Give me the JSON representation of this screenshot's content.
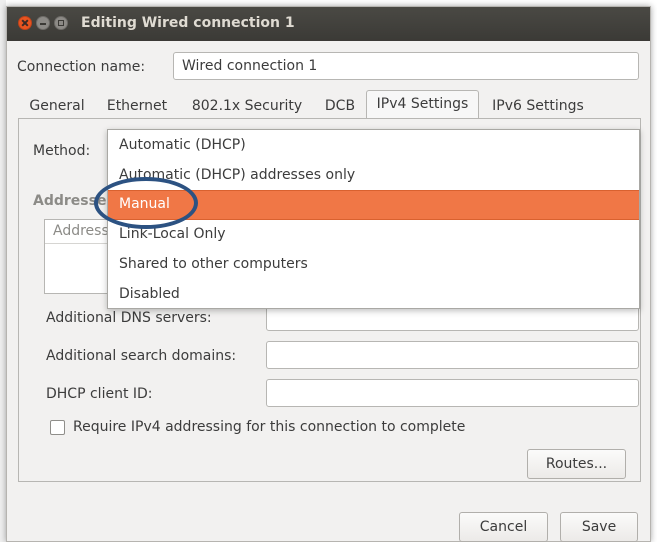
{
  "window": {
    "title": "Editing Wired connection 1"
  },
  "connection": {
    "label": "Connection name:",
    "value": "Wired connection 1"
  },
  "tabs": [
    {
      "label": "General"
    },
    {
      "label": "Ethernet"
    },
    {
      "label": "802.1x Security"
    },
    {
      "label": "DCB"
    },
    {
      "label": "IPv4 Settings"
    },
    {
      "label": "IPv6 Settings"
    }
  ],
  "active_tab": "IPv4 Settings",
  "ipv4": {
    "method_label": "Method:",
    "addresses_label": "Addresses",
    "addresses_column": "Address",
    "dns_label": "Additional DNS servers:",
    "search_label": "Additional search domains:",
    "dhcp_label": "DHCP client ID:",
    "require_label": "Require IPv4 addressing for this connection to complete",
    "routes_button": "Routes..."
  },
  "method_dropdown": {
    "options": [
      "Automatic (DHCP)",
      "Automatic (DHCP) addresses only",
      "Manual",
      "Link-Local Only",
      "Shared to other computers",
      "Disabled"
    ],
    "selected": "Manual",
    "highlight_color": "#f07746"
  },
  "buttons": {
    "cancel": "Cancel",
    "save": "Save"
  },
  "colors": {
    "accent": "#e95420",
    "titlebar": "#3b3a36",
    "annotation": "#2c5282"
  }
}
